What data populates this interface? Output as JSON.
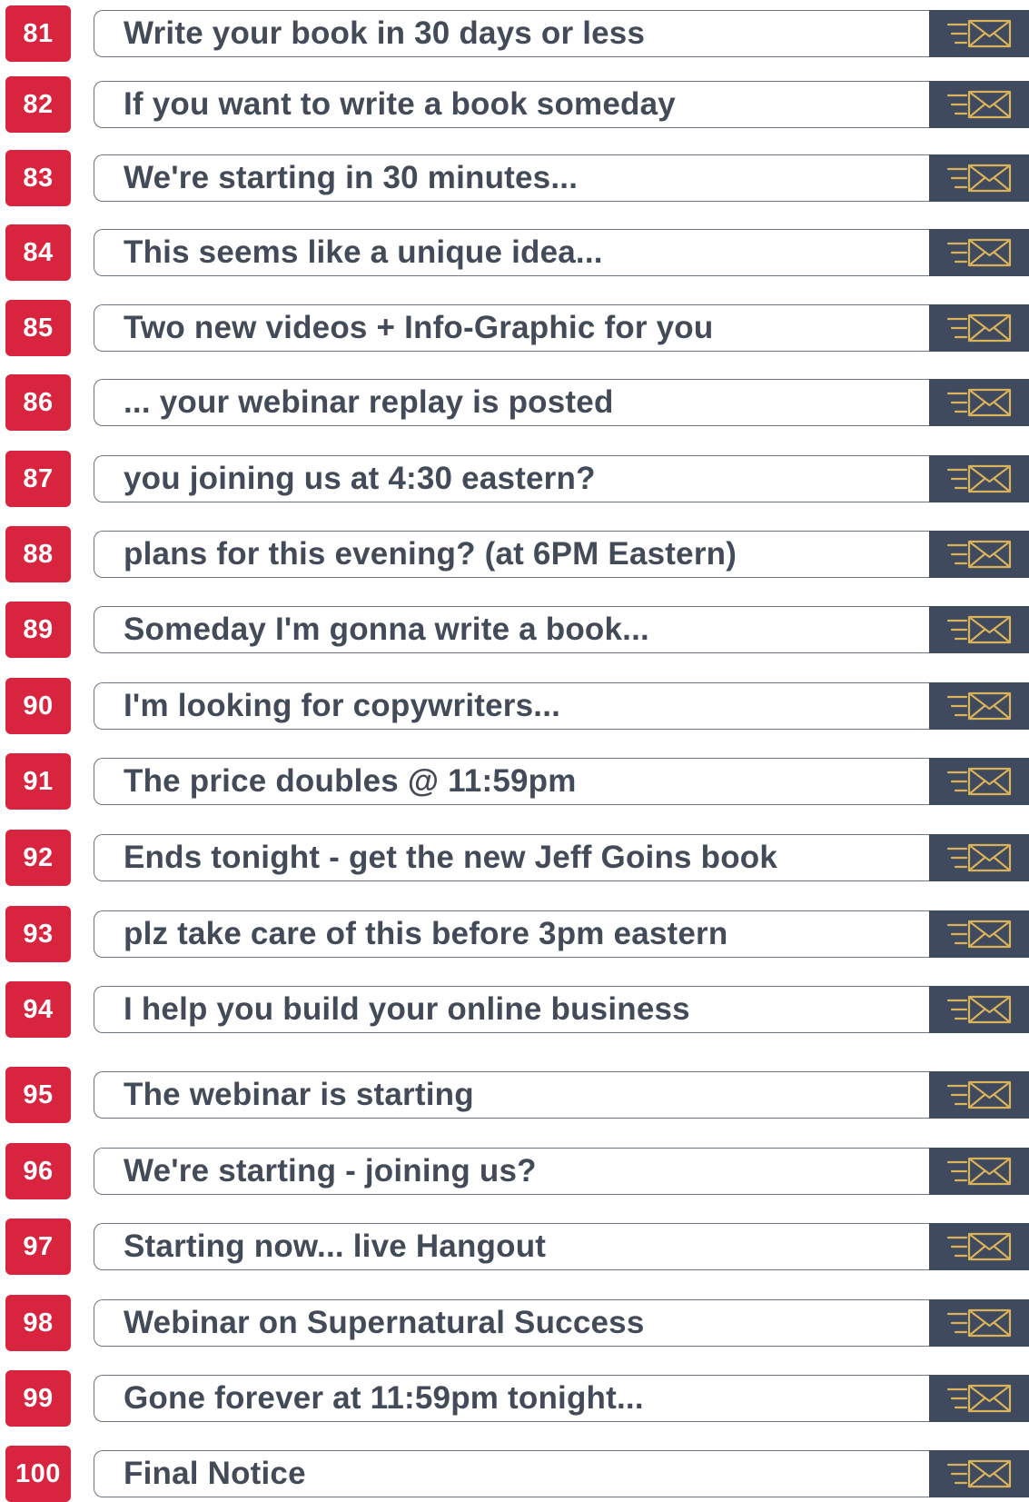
{
  "colors": {
    "badge": "#d8243e",
    "text": "#444b58",
    "button": "#3f4a5e",
    "icon": "#d9b25a"
  },
  "items": [
    {
      "number": "81",
      "subject": "Write your book in 30 days or less",
      "icon": "send-mail-icon"
    },
    {
      "number": "82",
      "subject": "If you want to write a book someday",
      "icon": "send-mail-icon"
    },
    {
      "number": "83",
      "subject": "We're starting in 30 minutes...",
      "icon": "send-mail-icon"
    },
    {
      "number": "84",
      "subject": "This seems like a unique idea...",
      "icon": "send-mail-icon"
    },
    {
      "number": "85",
      "subject": "Two new videos + Info-Graphic for you",
      "icon": "send-mail-icon"
    },
    {
      "number": "86",
      "subject": "... your webinar replay is posted",
      "icon": "send-mail-icon"
    },
    {
      "number": "87",
      "subject": "you joining us at 4:30 eastern?",
      "icon": "send-mail-icon"
    },
    {
      "number": "88",
      "subject": "plans for this evening? (at 6PM Eastern)",
      "icon": "send-mail-icon"
    },
    {
      "number": "89",
      "subject": "Someday I'm gonna write a book...",
      "icon": "send-mail-icon"
    },
    {
      "number": "90",
      "subject": "I'm looking for copywriters...",
      "icon": "send-mail-icon"
    },
    {
      "number": "91",
      "subject": "The price doubles @ 11:59pm",
      "icon": "send-mail-icon"
    },
    {
      "number": "92",
      "subject": "Ends tonight - get the new Jeff Goins book",
      "icon": "send-mail-icon"
    },
    {
      "number": "93",
      "subject": "plz take care of this before 3pm eastern",
      "icon": "send-mail-icon"
    },
    {
      "number": "94",
      "subject": "I help you build your online business",
      "icon": "send-mail-icon"
    },
    {
      "number": "95",
      "subject": "The webinar is starting",
      "icon": "send-mail-icon"
    },
    {
      "number": "96",
      "subject": "We're starting - joining us?",
      "icon": "send-mail-icon"
    },
    {
      "number": "97",
      "subject": "Starting now... live Hangout",
      "icon": "send-mail-icon"
    },
    {
      "number": "98",
      "subject": "Webinar on Supernatural Success",
      "icon": "send-mail-icon"
    },
    {
      "number": "99",
      "subject": "Gone forever at 11:59pm tonight...",
      "icon": "send-mail-icon"
    },
    {
      "number": "100",
      "subject": "Final Notice",
      "icon": "send-mail-icon"
    }
  ]
}
